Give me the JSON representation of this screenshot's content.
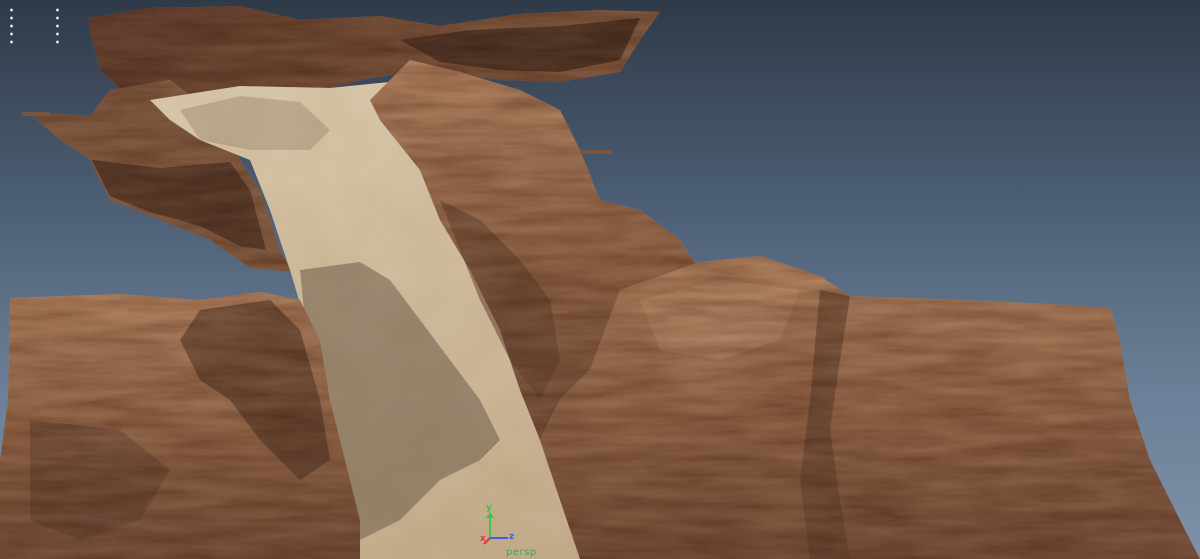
{
  "viewport": {
    "camera_name": "persp",
    "axes": {
      "x_label": "x",
      "y_label": "y",
      "z_label": "z"
    },
    "colors": {
      "axis_x": "#d43a3a",
      "axis_y": "#37c84a",
      "axis_z": "#3a63e0",
      "camera_label": "#3da844",
      "rock": "#9a6e4f",
      "rock_dark": "#5c3e2c",
      "sand": "#cdb89a"
    },
    "icons": {
      "grip": "drag-handle-dots",
      "gizmo": "axis-gizmo"
    }
  }
}
